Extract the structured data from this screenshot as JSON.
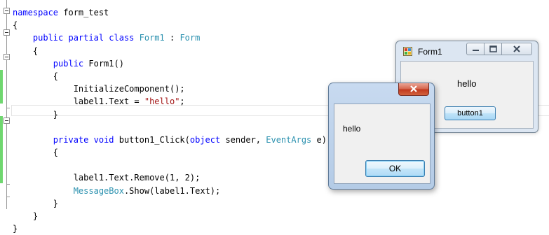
{
  "editor": {
    "lines": [
      [
        {
          "t": "namespace ",
          "c": "kw"
        },
        {
          "t": "form_test",
          "c": ""
        }
      ],
      [
        {
          "t": "{",
          "c": ""
        }
      ],
      [
        {
          "t": "    ",
          "c": ""
        },
        {
          "t": "public partial class ",
          "c": "kw"
        },
        {
          "t": "Form1",
          "c": "ty"
        },
        {
          "t": " : ",
          "c": ""
        },
        {
          "t": "Form",
          "c": "ty"
        }
      ],
      [
        {
          "t": "    {",
          "c": ""
        }
      ],
      [
        {
          "t": "        ",
          "c": ""
        },
        {
          "t": "public ",
          "c": "kw"
        },
        {
          "t": "Form1()",
          "c": ""
        }
      ],
      [
        {
          "t": "        {",
          "c": ""
        }
      ],
      [
        {
          "t": "            InitializeComponent();",
          "c": ""
        }
      ],
      [
        {
          "t": "            label1.Text = ",
          "c": ""
        },
        {
          "t": "\"hello\"",
          "c": "str"
        },
        {
          "t": ";",
          "c": ""
        }
      ],
      [
        {
          "t": "        }",
          "c": ""
        }
      ],
      [
        {
          "t": "",
          "c": ""
        }
      ],
      [
        {
          "t": "        ",
          "c": ""
        },
        {
          "t": "private void ",
          "c": "kw"
        },
        {
          "t": "button1_Click(",
          "c": ""
        },
        {
          "t": "object ",
          "c": "kw"
        },
        {
          "t": "sender, ",
          "c": ""
        },
        {
          "t": "EventArgs",
          "c": "ty"
        },
        {
          "t": " e)",
          "c": ""
        }
      ],
      [
        {
          "t": "        {",
          "c": ""
        }
      ],
      [
        {
          "t": "",
          "c": ""
        }
      ],
      [
        {
          "t": "            label1.Text.Remove(1, 2);",
          "c": ""
        }
      ],
      [
        {
          "t": "            ",
          "c": ""
        },
        {
          "t": "MessageBox",
          "c": "ty"
        },
        {
          "t": ".Show(label1.Text);",
          "c": ""
        }
      ],
      [
        {
          "t": "        }",
          "c": ""
        }
      ],
      [
        {
          "t": "    }",
          "c": ""
        }
      ],
      [
        {
          "t": "}",
          "c": ""
        }
      ]
    ]
  },
  "form1": {
    "title": "Form1",
    "label_text": "hello",
    "button_label": "button1"
  },
  "message_box": {
    "message": "hello",
    "ok_label": "OK"
  },
  "colors": {
    "keyword": "#0000ff",
    "type": "#2b91af",
    "string": "#a31515",
    "changed_marker": "#6fd76f"
  }
}
